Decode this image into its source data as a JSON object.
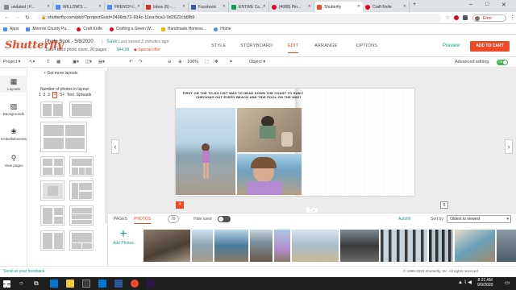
{
  "browser": {
    "tabs": [
      {
        "label": "undated | F...",
        "color": "#888"
      },
      {
        "label": "WILLOW'S ...",
        "color": "#4a8cf7"
      },
      {
        "label": "FRENCH I...",
        "color": "#4a8cf7"
      },
      {
        "label": "Inbox (5) -...",
        "color": "#d93025"
      },
      {
        "label": "Facebook",
        "color": "#3b5998"
      },
      {
        "label": "ENTIRE Co...",
        "color": "#0f9d58"
      },
      {
        "label": "(4088) Pin...",
        "color": "#e60023"
      },
      {
        "label": "Shutterfly",
        "color": "#ef4a25"
      },
      {
        "label": "Craft Knife",
        "color": "#e60023"
      }
    ],
    "url": "shutterfly.com/pb/#?projectGuid=2496dc72-914c-11ea-bca1-0d2622cb6fb9",
    "profile": "Error",
    "bookmarks": [
      {
        "label": "Apps",
        "color": "#4a8cf7"
      },
      {
        "label": "Monroe County Pu...",
        "color": "#4a8cf7"
      },
      {
        "label": "Craft Knife",
        "color": "#e60023"
      },
      {
        "label": "Crafting a Green W...",
        "color": "#e60023"
      },
      {
        "label": "Handmade Homesc...",
        "color": "#f4b400"
      },
      {
        "label": "Home",
        "color": "#4a8cf7"
      }
    ]
  },
  "app": {
    "brand": "Shutterfly",
    "project_title": "Photo Book - 5/8/2020",
    "save_label": "Save",
    "saved_status": "Last saved 2 minutes ago",
    "product_info": "11x14 Hard photo cover, 20 pages",
    "price": "$44.99",
    "special_offer": "Special offer",
    "nav": [
      "STYLE",
      "STORYBOARD",
      "EDIT",
      "ARRANGE",
      "OPTIONS"
    ],
    "preview_label": "Preview",
    "cart_label": "ADD TO CART"
  },
  "toolbar": {
    "project": "Project",
    "zoom": "100%",
    "object": "Object",
    "advanced_editing": "Advanced editing",
    "toggle": "ON"
  },
  "leftnav": [
    {
      "label": "Layouts",
      "icon": "layouts-icon"
    },
    {
      "label": "Backgrounds",
      "icon": "backgrounds-icon"
    },
    {
      "label": "Embellishments",
      "icon": "embellishments-icon"
    },
    {
      "label": "View pages",
      "icon": "view-pages-icon"
    }
  ],
  "layouts": {
    "get_more": "Get more layouts",
    "count_label": "Number of photos in layout",
    "counts": [
      "1",
      "2",
      "3",
      "4",
      "5+",
      "Text",
      "Spreads"
    ]
  },
  "page": {
    "caption": "FIRST ON THE TO-DO LIST WAS TO HEAD DOWN THE COAST TO SAN DIEGO, CHECKING OUT EVERY BEACH AND TIDE POOL ON THE WAY!",
    "left_page": "4",
    "right_page": "5"
  },
  "bottom": {
    "tabs": [
      "PAGES",
      "PHOTOS"
    ],
    "photo_count": "79",
    "hide_used": "Hide used",
    "autofill": "Autofill",
    "sort_by": "Sort by:",
    "sort_value": "Oldest to newest",
    "add_photos": "Add Photos"
  },
  "footer": {
    "feedback": "Send us your feedback",
    "copyright": "© 1999-2020 Shutterfly, Inc. All rights reserved."
  },
  "taskbar": {
    "time": "8:21 AM",
    "date": "9/9/2020"
  }
}
